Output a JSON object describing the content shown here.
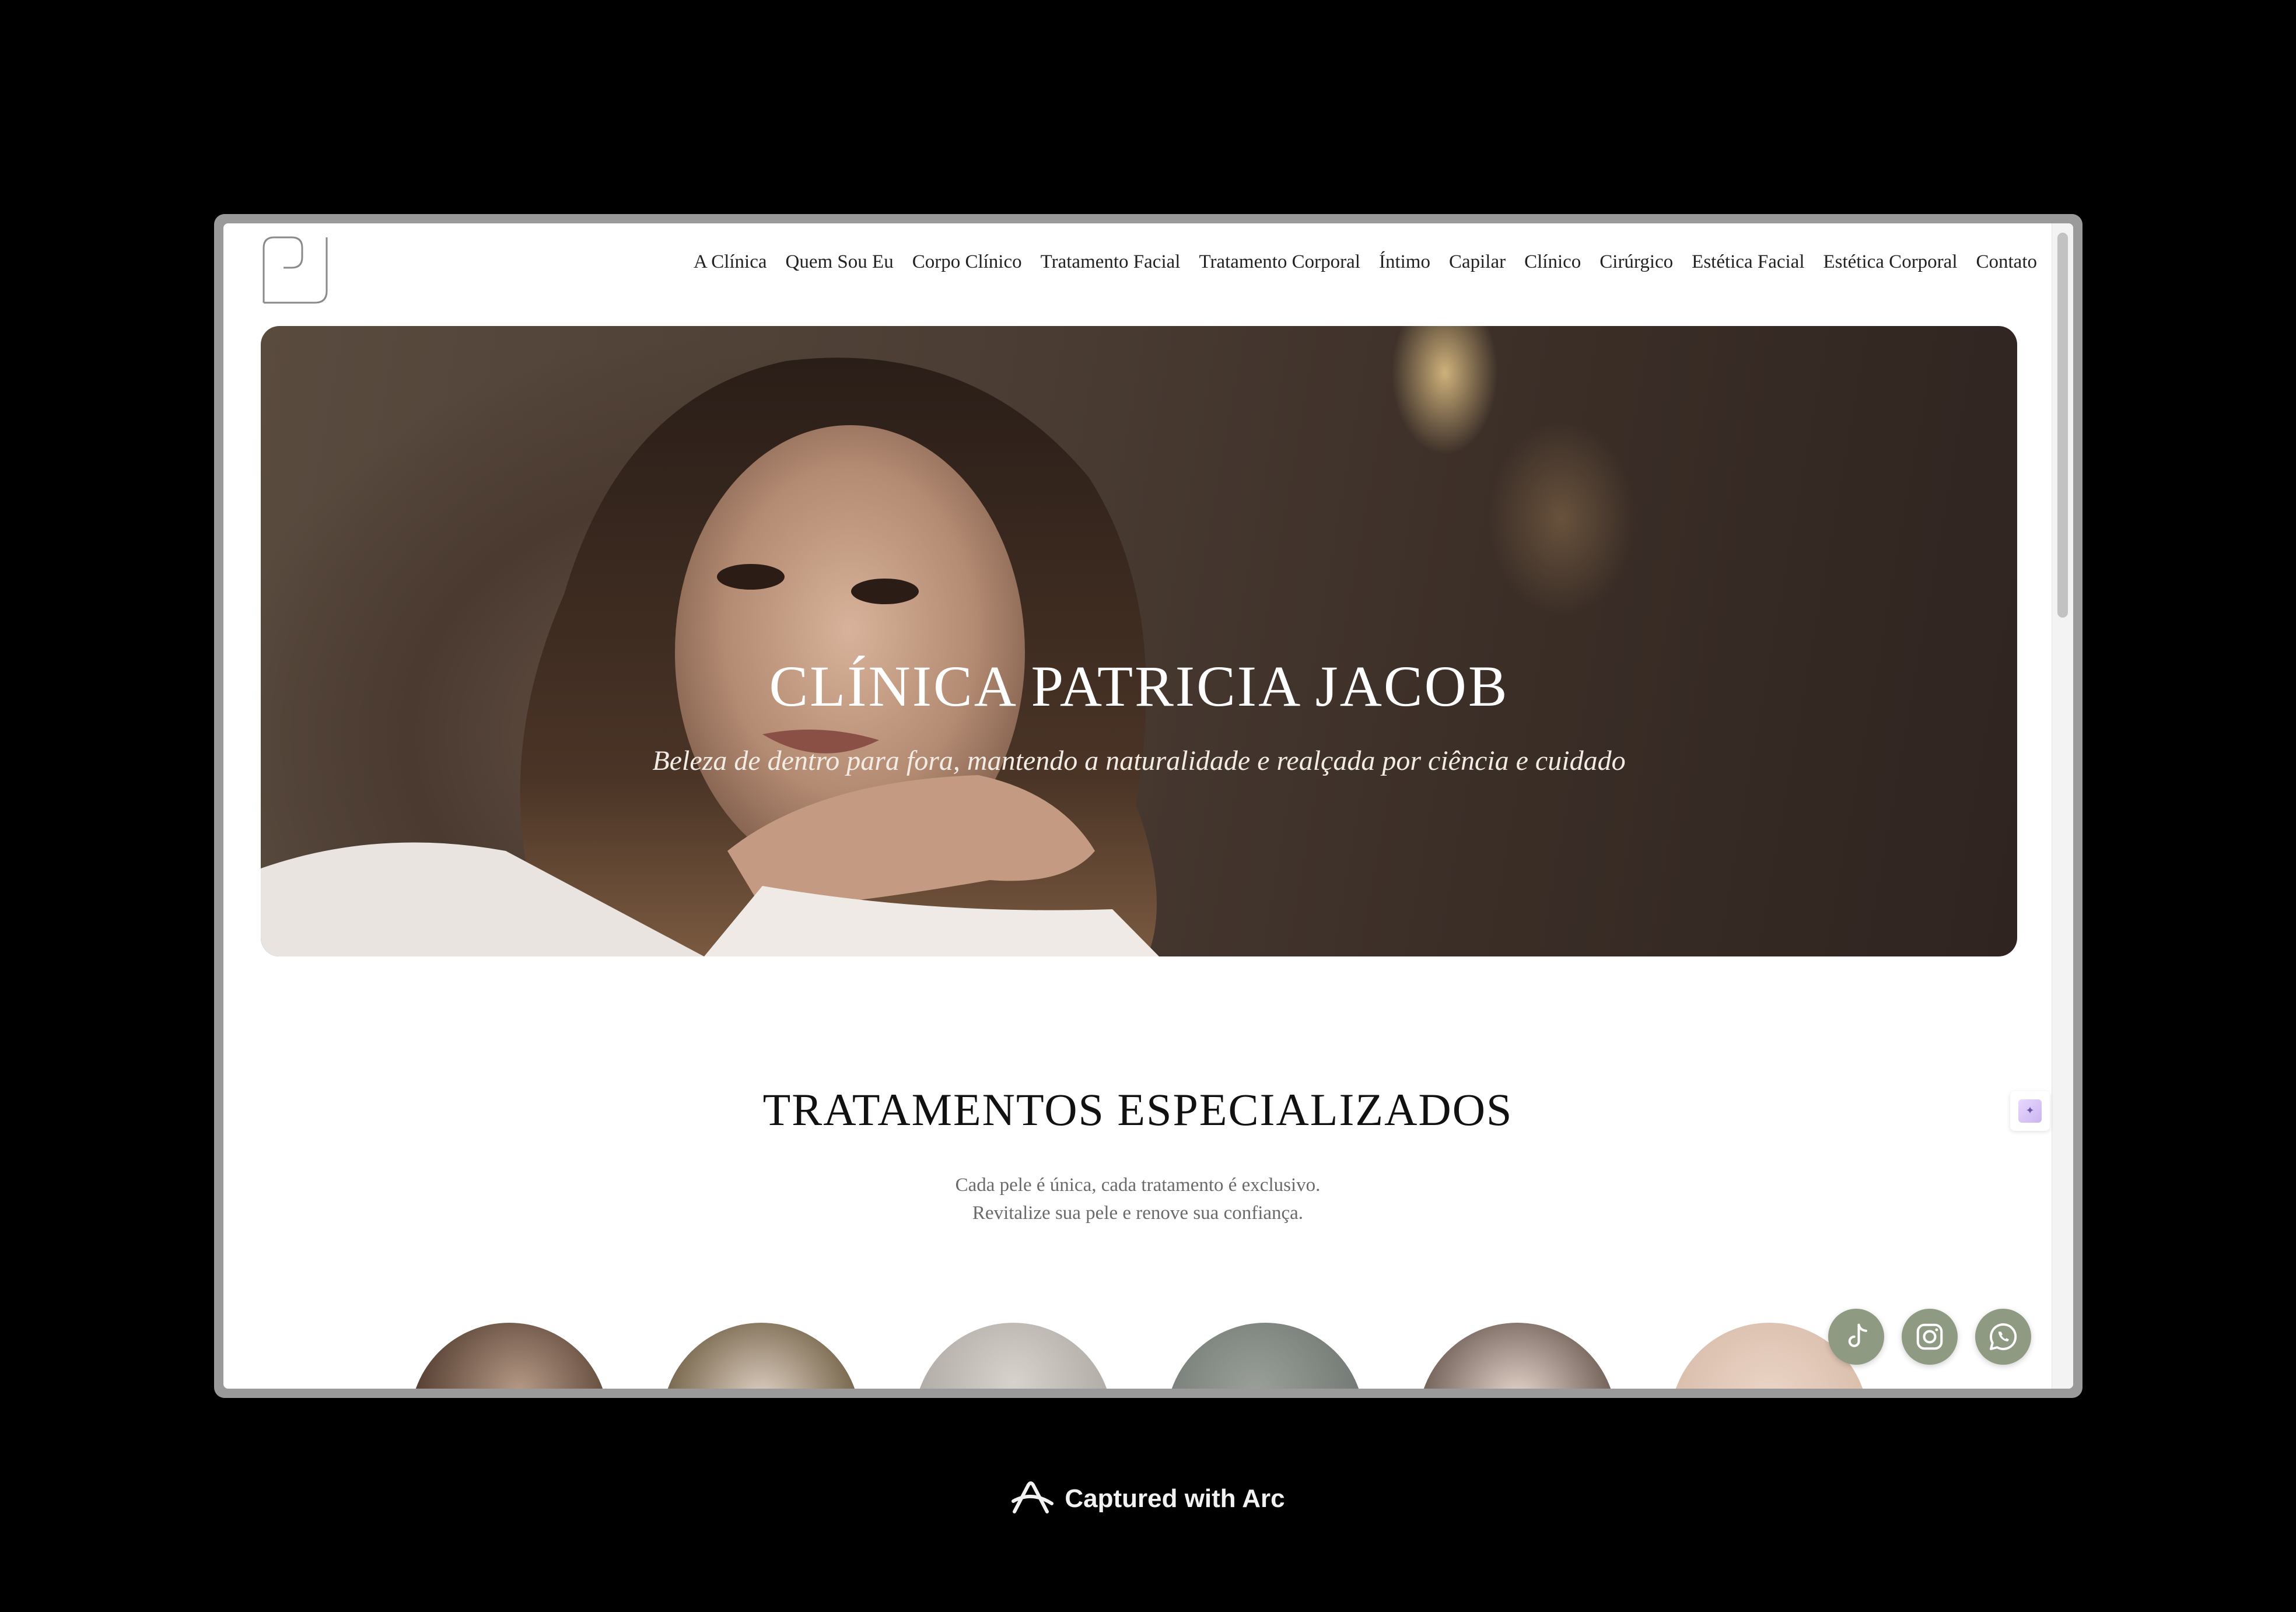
{
  "nav": {
    "items": [
      {
        "label": "A Clínica"
      },
      {
        "label": "Quem Sou Eu"
      },
      {
        "label": "Corpo Clínico"
      },
      {
        "label": "Tratamento Facial"
      },
      {
        "label": "Tratamento Corporal"
      },
      {
        "label": "Íntimo"
      },
      {
        "label": "Capilar"
      },
      {
        "label": "Clínico"
      },
      {
        "label": "Cirúrgico"
      },
      {
        "label": "Estética Facial"
      },
      {
        "label": "Estética Corporal"
      },
      {
        "label": "Contato"
      }
    ]
  },
  "hero": {
    "title": "CLÍNICA PATRICIA JACOB",
    "subtitle": "Beleza de dentro para fora, mantendo a naturalidade e realçada por ciência e cuidado"
  },
  "treatments": {
    "title": "TRATAMENTOS ESPECIALIZADOS",
    "subtitle_line1": "Cada pele é única, cada tratamento é exclusivo.",
    "subtitle_line2": "Revitalize sua pele e renove sua confiança."
  },
  "social": {
    "icons": [
      "tiktok-icon",
      "instagram-icon",
      "whatsapp-icon"
    ],
    "color": "#8f9a83"
  },
  "badge": {
    "text": "Captured with Arc"
  }
}
